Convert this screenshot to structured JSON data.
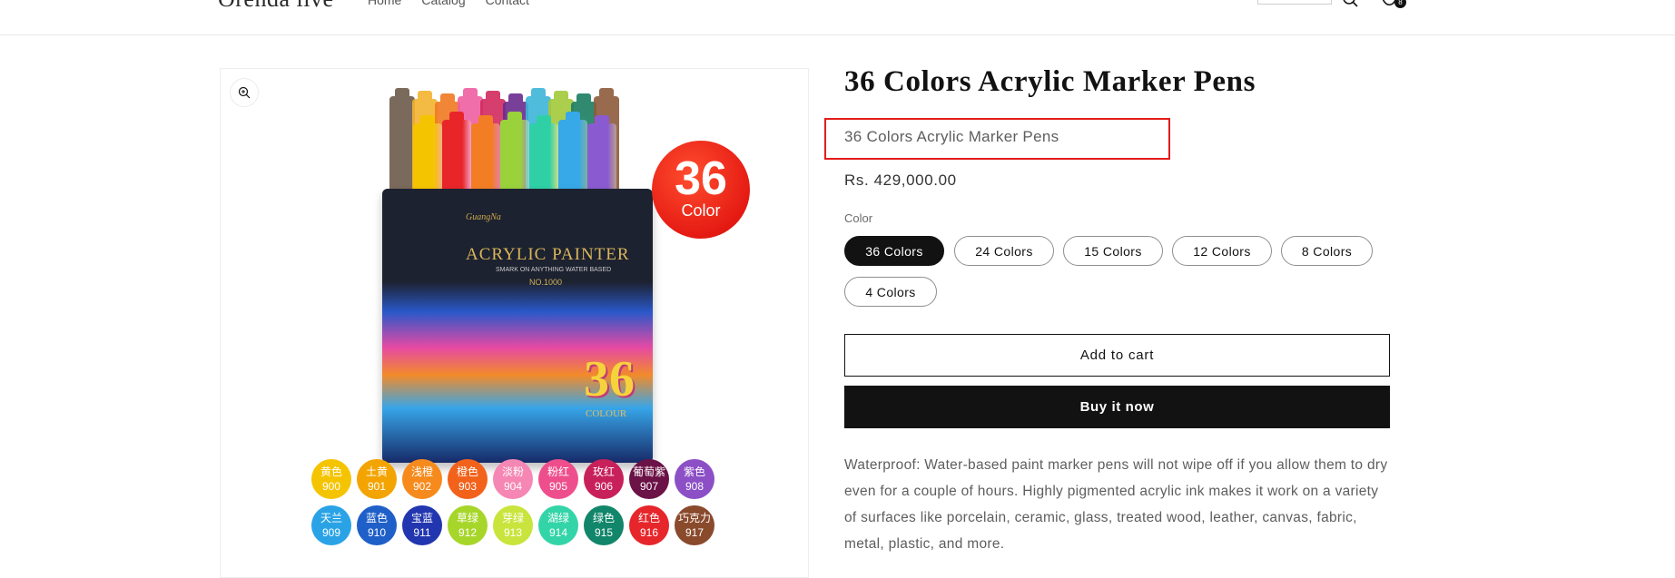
{
  "header": {
    "logo": "Orenda live",
    "nav": [
      "Home",
      "Catalog",
      "Contact"
    ],
    "cart_count": "8"
  },
  "product": {
    "title": "36 Colors Acrylic Marker Pens",
    "subtitle": "36 Colors Acrylic Marker Pens",
    "price": "Rs. 429,000.00",
    "color_label": "Color",
    "color_options": [
      "36 Colors",
      "24 Colors",
      "15 Colors",
      "12 Colors",
      "8 Colors",
      "4 Colors"
    ],
    "selected_color": "36 Colors",
    "add_to_cart_label": "Add to cart",
    "buy_now_label": "Buy it now",
    "description": "Waterproof: Water-based paint marker pens will not wipe off if you allow them to dry even for a couple of hours. Highly pigmented acrylic ink makes it work on a variety of surfaces like porcelain, ceramic, glass, treated wood, leather, canvas, fabric, metal, plastic, and more."
  },
  "image": {
    "badge_number": "36",
    "badge_word": "Color",
    "brand": "GuangNa",
    "painter": "ACRYLIC PAINTER",
    "small": "SMARK ON ANYTHING WATER BASED",
    "model": "NO.1000",
    "box_number": "36",
    "box_word": "COLOUR",
    "swatches_row1": [
      {
        "cn": "黄色",
        "code": "900",
        "color": "#f5c400"
      },
      {
        "cn": "土黄",
        "code": "901",
        "color": "#f3a400"
      },
      {
        "cn": "浅橙",
        "code": "902",
        "color": "#f68a1c"
      },
      {
        "cn": "橙色",
        "code": "903",
        "color": "#f2621a"
      },
      {
        "cn": "淡粉",
        "code": "904",
        "color": "#f686b3"
      },
      {
        "cn": "粉红",
        "code": "905",
        "color": "#ee4f8c"
      },
      {
        "cn": "玫红",
        "code": "906",
        "color": "#c8205a"
      },
      {
        "cn": "葡萄紫",
        "code": "907",
        "color": "#6b1247"
      },
      {
        "cn": "紫色",
        "code": "908",
        "color": "#8c4fc6"
      }
    ],
    "swatches_row2": [
      {
        "cn": "天兰",
        "code": "909",
        "color": "#2aa3e6"
      },
      {
        "cn": "蓝色",
        "code": "910",
        "color": "#1f5fc8"
      },
      {
        "cn": "宝蓝",
        "code": "911",
        "color": "#2236b0"
      },
      {
        "cn": "草绿",
        "code": "912",
        "color": "#a7d62a"
      },
      {
        "cn": "芽绿",
        "code": "913",
        "color": "#c9e43c"
      },
      {
        "cn": "湖绿",
        "code": "914",
        "color": "#33d4a8"
      },
      {
        "cn": "绿色",
        "code": "915",
        "color": "#11866a"
      },
      {
        "cn": "红色",
        "code": "916",
        "color": "#e6262a"
      },
      {
        "cn": "巧克力",
        "code": "917",
        "color": "#8a4a2c"
      }
    ]
  },
  "colors": {
    "accent": "#121212",
    "highlight_border": "#e21b1b"
  }
}
